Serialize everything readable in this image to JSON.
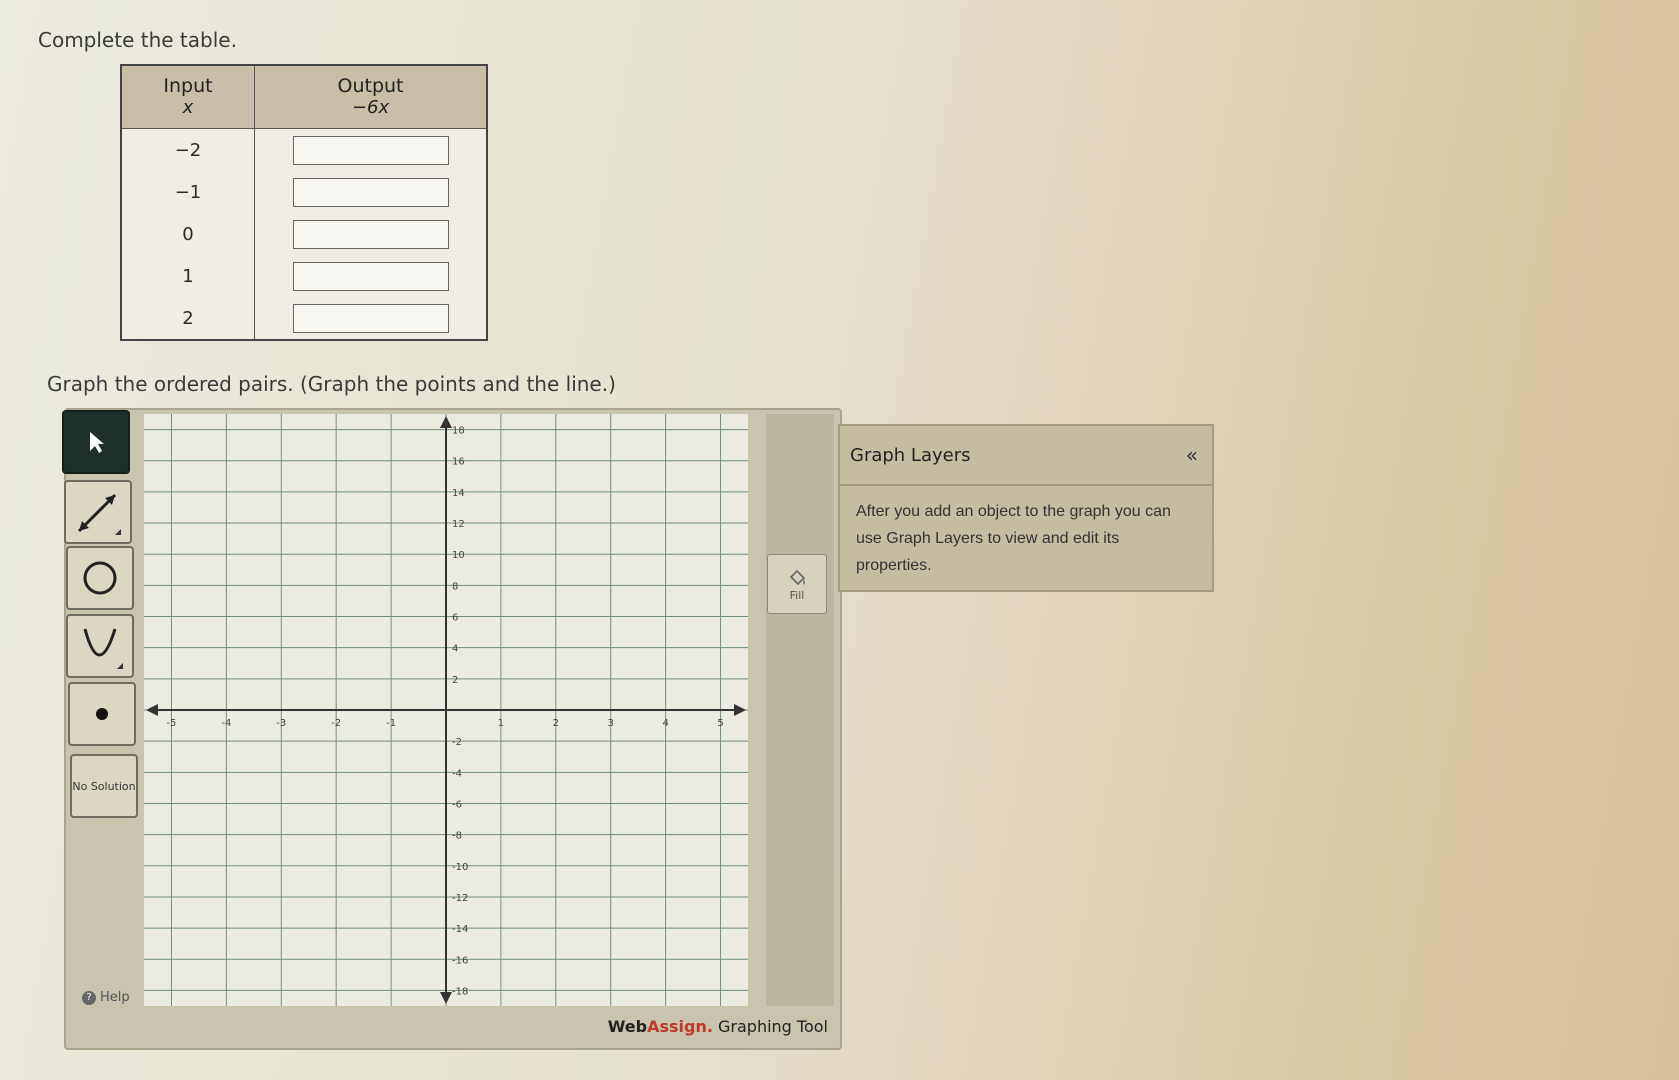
{
  "prompts": {
    "table": "Complete the table.",
    "graph": "Graph the ordered pairs. (Graph the points and the line.)"
  },
  "table": {
    "headers": [
      {
        "title": "Input",
        "sub": "x"
      },
      {
        "title": "Output",
        "sub": "−6x"
      }
    ],
    "rows": [
      {
        "input": "−2",
        "output": ""
      },
      {
        "input": "−1",
        "output": ""
      },
      {
        "input": "0",
        "output": ""
      },
      {
        "input": "1",
        "output": ""
      },
      {
        "input": "2",
        "output": ""
      }
    ]
  },
  "toolbar": {
    "tools": [
      {
        "name": "pointer-tool",
        "icon": "arrow-cursor-icon",
        "active": true
      },
      {
        "name": "line-tool",
        "icon": "line-segment-icon"
      },
      {
        "name": "circle-tool",
        "icon": "circle-icon"
      },
      {
        "name": "parabola-tool",
        "icon": "parabola-icon"
      },
      {
        "name": "point-tool",
        "icon": "dot-icon"
      }
    ],
    "no_solution_label": "No Solution",
    "help_label": "Help"
  },
  "graph": {
    "x_range": [
      -5.5,
      5.5
    ],
    "y_range": [
      -19,
      19
    ],
    "x_ticks": [
      -5,
      -4,
      -3,
      -2,
      -1,
      1,
      2,
      3,
      4,
      5
    ],
    "y_ticks": [
      18,
      16,
      14,
      12,
      10,
      8,
      6,
      4,
      2,
      -2,
      -4,
      -6,
      -8,
      -10,
      -12,
      -14,
      -16,
      -18
    ],
    "grid": true
  },
  "fill_label": "Fill",
  "brand": {
    "web": "Web",
    "assign": "Assign.",
    "rest": " Graphing Tool"
  },
  "layers": {
    "title": "Graph Layers",
    "collapse": "«",
    "body": "After you add an object to the graph you can use Graph Layers to view and edit its properties."
  },
  "colors": {
    "active_tool": "#1f2f2a",
    "brand_accent": "#c0392b",
    "grid_line": "#6f8f7a"
  }
}
